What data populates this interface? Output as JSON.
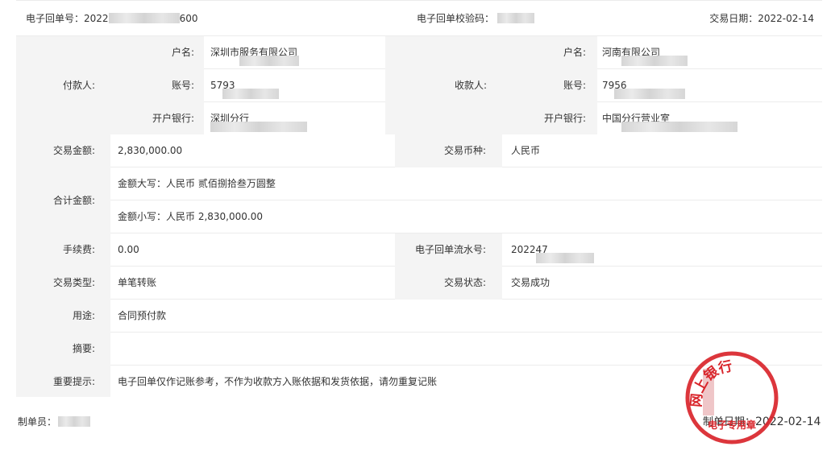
{
  "header": {
    "receipt_no_label": "电子回单号：",
    "receipt_no_start": "2022",
    "receipt_no_end": "600",
    "verify_label": "电子回单校验码：",
    "date_label": "交易日期：",
    "date_value": "2022-02-14"
  },
  "payer": {
    "section_label": "付款人:",
    "name_label": "户名:",
    "name_start": "深圳市",
    "name_end": "服务有限公司",
    "account_label": "账号:",
    "account_start": "57",
    "account_end": "93",
    "bank_label": "开户银行:",
    "bank_end": "深圳分行"
  },
  "payee": {
    "section_label": "收款人:",
    "name_label": "户名:",
    "name_start": "河南",
    "name_end": "有限公司",
    "account_label": "账号:",
    "account_start": "79",
    "account_end": "56",
    "bank_label": "开户银行:",
    "bank_start": "中国",
    "bank_end": "分行营业室"
  },
  "amount": {
    "label": "交易金额:",
    "value": "2,830,000.00",
    "currency_label": "交易币种:",
    "currency_value": "人民币"
  },
  "total": {
    "label": "合计金额:",
    "upper_line": "金额大写：人民币 贰佰捌拾叁万圆整",
    "lower_line": "金额小写：人民币 2,830,000.00"
  },
  "fee": {
    "label": "手续费:",
    "value": "0.00",
    "serial_label": "电子回单流水号:",
    "serial_start": "2022",
    "serial_end": "47"
  },
  "tx": {
    "type_label": "交易类型:",
    "type_value": "单笔转账",
    "status_label": "交易状态:",
    "status_value": "交易成功"
  },
  "purpose": {
    "label": "用途:",
    "value": "合同预付款"
  },
  "summary": {
    "label": "摘要:",
    "value": ""
  },
  "notice": {
    "label": "重要提示:",
    "value": "电子回单仅作记账参考，不作为收款方入账依据和发货依据，请勿重复记账"
  },
  "footer": {
    "maker_label": "制单员：",
    "make_date_label": "制单日期：",
    "make_date_value": "2022-02-14"
  },
  "stamp": {
    "top_text": "网上银行",
    "bottom_text": "电子专用章",
    "color": "#d9252b"
  }
}
